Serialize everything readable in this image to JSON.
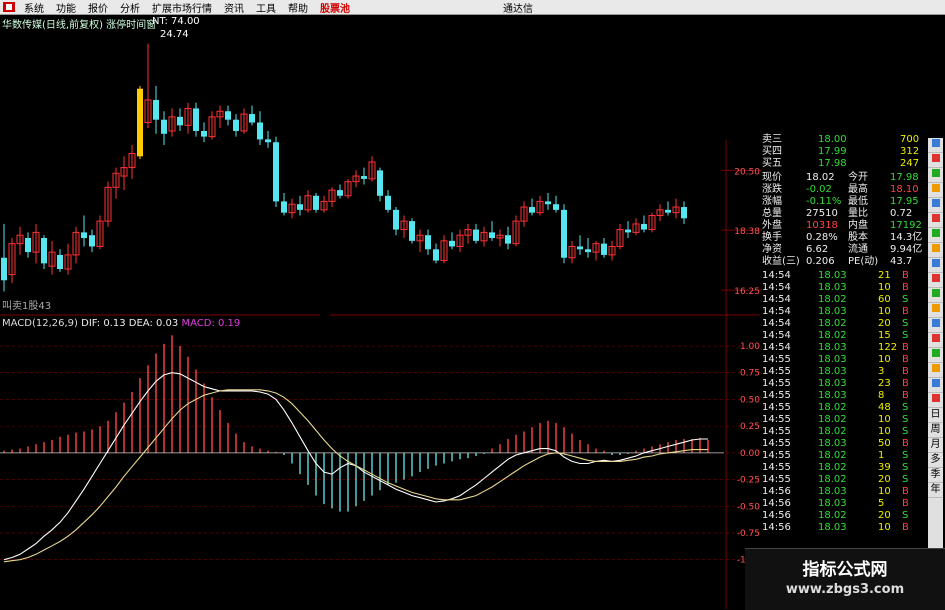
{
  "menu": [
    {
      "label": "系统"
    },
    {
      "label": "功能"
    },
    {
      "label": "报价"
    },
    {
      "label": "分析"
    },
    {
      "label": "扩展市场行情"
    },
    {
      "label": "资讯"
    },
    {
      "label": "工具"
    },
    {
      "label": "帮助"
    },
    {
      "label": "股票池",
      "active": true
    }
  ],
  "brand": "通达信",
  "stock_title": "华数传媒(日线,前复权) 涨停时间窗",
  "nt_label": "NT: 74.00",
  "top_marker": "24.74",
  "volume_note": "叫卖1股43",
  "price_axis": [
    "20.50",
    "18.38",
    "16.25"
  ],
  "macd_legend": {
    "name": "MACD(12,26,9)",
    "dif": "DIF: 0.13",
    "dea": "DEA: 0.03",
    "macd": "MACD: 0.19"
  },
  "macd_axis": [
    "1.00",
    "0.75",
    "0.50",
    "0.25",
    "0.00",
    "-0.25",
    "-0.50",
    "-0.75",
    "-1.00"
  ],
  "order_book": [
    {
      "label": "卖三",
      "price": "18.00",
      "vol": "700"
    },
    {
      "label": "买四",
      "price": "17.99",
      "vol": "312"
    },
    {
      "label": "买五",
      "price": "17.98",
      "vol": "247"
    }
  ],
  "stats": [
    {
      "l1": "现价",
      "v1": "18.02",
      "l2": "今开",
      "v2": "17.98"
    },
    {
      "l1": "涨跌",
      "v1": "-0.02",
      "l2": "最高",
      "v2": "18.10"
    },
    {
      "l1": "涨幅",
      "v1": "-0.11%",
      "l2": "最低",
      "v2": "17.95"
    },
    {
      "l1": "总量",
      "v1": "27510",
      "l2": "量比",
      "v2": "0.72"
    },
    {
      "l1": "外盘",
      "v1": "10318",
      "l2": "内盘",
      "v2": "17192"
    },
    {
      "l1": "换手",
      "v1": "0.28%",
      "l2": "股本",
      "v2": "14.3亿"
    },
    {
      "l1": "净资",
      "v1": "6.62",
      "l2": "流通",
      "v2": "9.94亿"
    },
    {
      "l1": "收益(三)",
      "v1": "0.206",
      "l2": "PE(动)",
      "v2": "43.7"
    }
  ],
  "ticks": [
    {
      "t": "14:54",
      "p": "18.03",
      "v": "21",
      "s": "B"
    },
    {
      "t": "14:54",
      "p": "18.03",
      "v": "10",
      "s": "B"
    },
    {
      "t": "14:54",
      "p": "18.02",
      "v": "60",
      "s": "S"
    },
    {
      "t": "14:54",
      "p": "18.03",
      "v": "10",
      "s": "B"
    },
    {
      "t": "14:54",
      "p": "18.02",
      "v": "20",
      "s": "S"
    },
    {
      "t": "14:54",
      "p": "18.02",
      "v": "15",
      "s": "S"
    },
    {
      "t": "14:54",
      "p": "18.03",
      "v": "122",
      "s": "B"
    },
    {
      "t": "14:55",
      "p": "18.03",
      "v": "10",
      "s": "B"
    },
    {
      "t": "14:55",
      "p": "18.03",
      "v": "3",
      "s": "B"
    },
    {
      "t": "14:55",
      "p": "18.03",
      "v": "23",
      "s": "B"
    },
    {
      "t": "14:55",
      "p": "18.03",
      "v": "8",
      "s": "B"
    },
    {
      "t": "14:55",
      "p": "18.02",
      "v": "48",
      "s": "S"
    },
    {
      "t": "14:55",
      "p": "18.02",
      "v": "10",
      "s": "S"
    },
    {
      "t": "14:55",
      "p": "18.02",
      "v": "10",
      "s": "S"
    },
    {
      "t": "14:55",
      "p": "18.03",
      "v": "50",
      "s": "B"
    },
    {
      "t": "14:55",
      "p": "18.02",
      "v": "1",
      "s": "S"
    },
    {
      "t": "14:55",
      "p": "18.02",
      "v": "39",
      "s": "S"
    },
    {
      "t": "14:55",
      "p": "18.02",
      "v": "20",
      "s": "S"
    },
    {
      "t": "14:56",
      "p": "18.03",
      "v": "10",
      "s": "B"
    },
    {
      "t": "14:56",
      "p": "18.03",
      "v": "5",
      "s": "B"
    },
    {
      "t": "14:56",
      "p": "18.02",
      "v": "20",
      "s": "S"
    },
    {
      "t": "14:56",
      "p": "18.03",
      "v": "10",
      "s": "B"
    }
  ],
  "toolbar_labels": [
    "日",
    "周",
    "月",
    "多",
    "季",
    "年"
  ],
  "watermark": {
    "title": "指标公式网",
    "url": "www.zbgs3.com"
  },
  "colors": {
    "up": "#ff3333",
    "down": "#55e6f0",
    "limit_up": "#ffcc00",
    "grid": "#7a0000",
    "text_green": "#33dd33",
    "text_red": "#ff4444"
  },
  "chart_data": [
    {
      "type": "candlestick",
      "title": "华数传媒(日线,前复权) 涨停时间窗",
      "ylim": [
        15.9,
        25.2
      ],
      "y_ticks": [
        20.5,
        18.38,
        16.25
      ],
      "candles": [
        {
          "o": 17.4,
          "h": 18.6,
          "l": 16.2,
          "c": 16.6
        },
        {
          "o": 16.8,
          "h": 18.1,
          "l": 16.5,
          "c": 17.9
        },
        {
          "o": 17.9,
          "h": 18.5,
          "l": 17.5,
          "c": 18.2
        },
        {
          "o": 18.1,
          "h": 18.3,
          "l": 17.4,
          "c": 17.6
        },
        {
          "o": 17.6,
          "h": 18.6,
          "l": 17.2,
          "c": 18.3
        },
        {
          "o": 18.1,
          "h": 18.2,
          "l": 17.0,
          "c": 17.2
        },
        {
          "o": 17.1,
          "h": 18.0,
          "l": 16.8,
          "c": 17.6
        },
        {
          "o": 17.5,
          "h": 17.7,
          "l": 16.9,
          "c": 17.0
        },
        {
          "o": 17.0,
          "h": 17.9,
          "l": 16.8,
          "c": 17.5
        },
        {
          "o": 17.5,
          "h": 18.5,
          "l": 17.2,
          "c": 18.3
        },
        {
          "o": 18.3,
          "h": 18.9,
          "l": 17.8,
          "c": 18.1
        },
        {
          "o": 18.2,
          "h": 18.4,
          "l": 17.6,
          "c": 17.8
        },
        {
          "o": 17.8,
          "h": 18.9,
          "l": 17.7,
          "c": 18.7
        },
        {
          "o": 18.7,
          "h": 20.1,
          "l": 18.5,
          "c": 19.9
        },
        {
          "o": 19.9,
          "h": 20.6,
          "l": 19.5,
          "c": 20.4
        },
        {
          "o": 20.3,
          "h": 21.0,
          "l": 19.8,
          "c": 20.6
        },
        {
          "o": 20.6,
          "h": 21.4,
          "l": 20.2,
          "c": 21.1
        },
        {
          "o": 21.0,
          "h": 23.5,
          "l": 20.9,
          "c": 23.4
        },
        {
          "o": 22.2,
          "h": 25.0,
          "l": 22.0,
          "c": 23.0
        },
        {
          "o": 23.0,
          "h": 23.5,
          "l": 21.8,
          "c": 22.3
        },
        {
          "o": 22.3,
          "h": 22.6,
          "l": 21.4,
          "c": 21.8
        },
        {
          "o": 21.9,
          "h": 22.7,
          "l": 21.7,
          "c": 22.4
        },
        {
          "o": 22.4,
          "h": 22.7,
          "l": 21.9,
          "c": 22.1
        },
        {
          "o": 22.1,
          "h": 22.9,
          "l": 21.8,
          "c": 22.7
        },
        {
          "o": 22.7,
          "h": 22.9,
          "l": 21.7,
          "c": 21.9
        },
        {
          "o": 21.9,
          "h": 22.2,
          "l": 21.5,
          "c": 21.7
        },
        {
          "o": 21.7,
          "h": 22.6,
          "l": 21.6,
          "c": 22.4
        },
        {
          "o": 22.4,
          "h": 22.8,
          "l": 22.0,
          "c": 22.6
        },
        {
          "o": 22.6,
          "h": 22.8,
          "l": 22.1,
          "c": 22.3
        },
        {
          "o": 22.3,
          "h": 22.5,
          "l": 21.7,
          "c": 21.9
        },
        {
          "o": 21.9,
          "h": 22.7,
          "l": 21.8,
          "c": 22.5
        },
        {
          "o": 22.5,
          "h": 22.8,
          "l": 22.1,
          "c": 22.2
        },
        {
          "o": 22.2,
          "h": 22.6,
          "l": 21.4,
          "c": 21.6
        },
        {
          "o": 21.6,
          "h": 21.9,
          "l": 21.3,
          "c": 21.5
        },
        {
          "o": 21.5,
          "h": 21.7,
          "l": 19.2,
          "c": 19.4
        },
        {
          "o": 19.4,
          "h": 19.7,
          "l": 18.9,
          "c": 19.0
        },
        {
          "o": 19.0,
          "h": 19.5,
          "l": 18.8,
          "c": 19.3
        },
        {
          "o": 19.3,
          "h": 19.6,
          "l": 18.9,
          "c": 19.1
        },
        {
          "o": 19.1,
          "h": 19.8,
          "l": 19.0,
          "c": 19.6
        },
        {
          "o": 19.6,
          "h": 19.7,
          "l": 19.0,
          "c": 19.1
        },
        {
          "o": 19.1,
          "h": 19.6,
          "l": 19.0,
          "c": 19.4
        },
        {
          "o": 19.4,
          "h": 19.9,
          "l": 19.2,
          "c": 19.8
        },
        {
          "o": 19.8,
          "h": 20.0,
          "l": 19.5,
          "c": 19.6
        },
        {
          "o": 19.6,
          "h": 20.2,
          "l": 19.5,
          "c": 20.1
        },
        {
          "o": 20.1,
          "h": 20.5,
          "l": 19.9,
          "c": 20.3
        },
        {
          "o": 20.3,
          "h": 20.6,
          "l": 20.0,
          "c": 20.2
        },
        {
          "o": 20.2,
          "h": 21.0,
          "l": 20.1,
          "c": 20.8
        },
        {
          "o": 20.5,
          "h": 20.6,
          "l": 19.4,
          "c": 19.6
        },
        {
          "o": 19.6,
          "h": 19.8,
          "l": 19.0,
          "c": 19.1
        },
        {
          "o": 19.1,
          "h": 19.2,
          "l": 18.2,
          "c": 18.4
        },
        {
          "o": 18.4,
          "h": 18.9,
          "l": 18.1,
          "c": 18.7
        },
        {
          "o": 18.7,
          "h": 18.8,
          "l": 17.9,
          "c": 18.0
        },
        {
          "o": 18.0,
          "h": 18.4,
          "l": 17.6,
          "c": 18.2
        },
        {
          "o": 18.2,
          "h": 18.4,
          "l": 17.5,
          "c": 17.7
        },
        {
          "o": 17.7,
          "h": 17.9,
          "l": 17.2,
          "c": 17.3
        },
        {
          "o": 17.3,
          "h": 18.2,
          "l": 17.2,
          "c": 18.0
        },
        {
          "o": 18.0,
          "h": 18.3,
          "l": 17.7,
          "c": 17.8
        },
        {
          "o": 17.8,
          "h": 18.4,
          "l": 17.6,
          "c": 18.2
        },
        {
          "o": 18.2,
          "h": 18.6,
          "l": 17.9,
          "c": 18.4
        },
        {
          "o": 18.4,
          "h": 18.6,
          "l": 17.9,
          "c": 18.0
        },
        {
          "o": 18.0,
          "h": 18.5,
          "l": 17.8,
          "c": 18.3
        },
        {
          "o": 18.3,
          "h": 18.7,
          "l": 18.0,
          "c": 18.1
        },
        {
          "o": 18.1,
          "h": 18.4,
          "l": 17.8,
          "c": 18.2
        },
        {
          "o": 18.2,
          "h": 18.5,
          "l": 17.7,
          "c": 17.9
        },
        {
          "o": 17.9,
          "h": 18.9,
          "l": 17.8,
          "c": 18.7
        },
        {
          "o": 18.7,
          "h": 19.4,
          "l": 18.5,
          "c": 19.2
        },
        {
          "o": 19.2,
          "h": 19.5,
          "l": 18.9,
          "c": 19.0
        },
        {
          "o": 19.0,
          "h": 19.6,
          "l": 18.9,
          "c": 19.4
        },
        {
          "o": 19.4,
          "h": 19.7,
          "l": 19.1,
          "c": 19.3
        },
        {
          "o": 19.3,
          "h": 19.6,
          "l": 19.0,
          "c": 19.1
        },
        {
          "o": 19.1,
          "h": 19.3,
          "l": 17.2,
          "c": 17.4
        },
        {
          "o": 17.4,
          "h": 18.0,
          "l": 17.2,
          "c": 17.8
        },
        {
          "o": 17.8,
          "h": 18.2,
          "l": 17.5,
          "c": 17.7
        },
        {
          "o": 17.7,
          "h": 18.1,
          "l": 17.4,
          "c": 17.6
        },
        {
          "o": 17.6,
          "h": 18.0,
          "l": 17.3,
          "c": 17.9
        },
        {
          "o": 17.9,
          "h": 18.1,
          "l": 17.4,
          "c": 17.5
        },
        {
          "o": 17.5,
          "h": 18.0,
          "l": 17.3,
          "c": 17.8
        },
        {
          "o": 17.8,
          "h": 18.6,
          "l": 17.7,
          "c": 18.4
        },
        {
          "o": 18.4,
          "h": 18.7,
          "l": 18.1,
          "c": 18.3
        },
        {
          "o": 18.3,
          "h": 18.8,
          "l": 18.2,
          "c": 18.6
        },
        {
          "o": 18.6,
          "h": 18.9,
          "l": 18.3,
          "c": 18.4
        },
        {
          "o": 18.4,
          "h": 19.0,
          "l": 18.3,
          "c": 18.9
        },
        {
          "o": 18.9,
          "h": 19.3,
          "l": 18.7,
          "c": 19.1
        },
        {
          "o": 19.1,
          "h": 19.4,
          "l": 18.9,
          "c": 19.0
        },
        {
          "o": 19.0,
          "h": 19.5,
          "l": 18.8,
          "c": 19.2
        },
        {
          "o": 19.2,
          "h": 19.4,
          "l": 18.6,
          "c": 18.8
        }
      ]
    },
    {
      "type": "bar",
      "title": "MACD(12,26,9)",
      "ylim": [
        -1.05,
        1.15
      ],
      "y_ticks": [
        1.0,
        0.75,
        0.5,
        0.25,
        0.0,
        -0.25,
        -0.5,
        -0.75,
        -1.0
      ],
      "series": [
        {
          "name": "MACD",
          "values": [
            0.02,
            0.03,
            0.04,
            0.06,
            0.08,
            0.1,
            0.12,
            0.15,
            0.17,
            0.19,
            0.2,
            0.22,
            0.25,
            0.3,
            0.38,
            0.47,
            0.57,
            0.7,
            0.82,
            0.93,
            1.02,
            1.1,
            1.0,
            0.9,
            0.78,
            0.65,
            0.52,
            0.4,
            0.28,
            0.18,
            0.1,
            0.06,
            0.04,
            0.02,
            0.01,
            -0.02,
            -0.1,
            -0.2,
            -0.3,
            -0.4,
            -0.48,
            -0.52,
            -0.55,
            -0.55,
            -0.5,
            -0.45,
            -0.4,
            -0.35,
            -0.3,
            -0.28,
            -0.25,
            -0.22,
            -0.18,
            -0.15,
            -0.12,
            -0.1,
            -0.08,
            -0.06,
            -0.05,
            -0.03,
            -0.01,
            0.04,
            0.08,
            0.13,
            0.17,
            0.2,
            0.24,
            0.28,
            0.3,
            0.28,
            0.24,
            0.18,
            0.12,
            0.08,
            0.04,
            0.02,
            -0.02,
            -0.02,
            -0.01,
            0.02,
            0.04,
            0.06,
            0.08,
            0.1,
            0.12,
            0.13,
            0.13,
            0.14,
            0.12
          ]
        },
        {
          "name": "DIF",
          "values": [
            -1.0,
            -0.98,
            -0.95,
            -0.9,
            -0.85,
            -0.78,
            -0.72,
            -0.65,
            -0.56,
            -0.45,
            -0.34,
            -0.22,
            -0.1,
            0.02,
            0.14,
            0.26,
            0.37,
            0.48,
            0.58,
            0.67,
            0.73,
            0.75,
            0.74,
            0.7,
            0.66,
            0.62,
            0.6,
            0.58,
            0.58,
            0.58,
            0.58,
            0.58,
            0.57,
            0.55,
            0.5,
            0.4,
            0.28,
            0.15,
            0.02,
            -0.1,
            -0.18,
            -0.2,
            -0.14,
            -0.1,
            -0.12,
            -0.18,
            -0.22,
            -0.26,
            -0.3,
            -0.34,
            -0.37,
            -0.4,
            -0.42,
            -0.44,
            -0.46,
            -0.45,
            -0.43,
            -0.4,
            -0.35,
            -0.3,
            -0.24,
            -0.18,
            -0.12,
            -0.06,
            -0.02,
            0.0,
            0.02,
            0.04,
            0.04,
            0.02,
            -0.04,
            -0.08,
            -0.1,
            -0.1,
            -0.08,
            -0.07,
            -0.08,
            -0.07,
            -0.05,
            -0.03,
            0.0,
            0.02,
            0.04,
            0.06,
            0.08,
            0.1,
            0.12,
            0.13,
            0.13
          ]
        },
        {
          "name": "DEA",
          "values": [
            -1.02,
            -1.01,
            -1.0,
            -0.98,
            -0.95,
            -0.91,
            -0.87,
            -0.83,
            -0.78,
            -0.72,
            -0.65,
            -0.58,
            -0.5,
            -0.41,
            -0.32,
            -0.22,
            -0.13,
            -0.04,
            0.05,
            0.14,
            0.23,
            0.32,
            0.4,
            0.46,
            0.5,
            0.54,
            0.56,
            0.58,
            0.59,
            0.59,
            0.59,
            0.59,
            0.59,
            0.58,
            0.56,
            0.52,
            0.46,
            0.38,
            0.3,
            0.21,
            0.12,
            0.04,
            -0.03,
            -0.08,
            -0.12,
            -0.16,
            -0.2,
            -0.24,
            -0.28,
            -0.31,
            -0.34,
            -0.37,
            -0.39,
            -0.41,
            -0.43,
            -0.44,
            -0.44,
            -0.44,
            -0.42,
            -0.4,
            -0.36,
            -0.32,
            -0.27,
            -0.22,
            -0.17,
            -0.12,
            -0.08,
            -0.04,
            -0.01,
            0.0,
            -0.01,
            -0.03,
            -0.05,
            -0.07,
            -0.08,
            -0.08,
            -0.08,
            -0.08,
            -0.07,
            -0.06,
            -0.04,
            -0.03,
            -0.01,
            0.0,
            0.01,
            0.02,
            0.03,
            0.03,
            0.03
          ]
        }
      ]
    }
  ]
}
